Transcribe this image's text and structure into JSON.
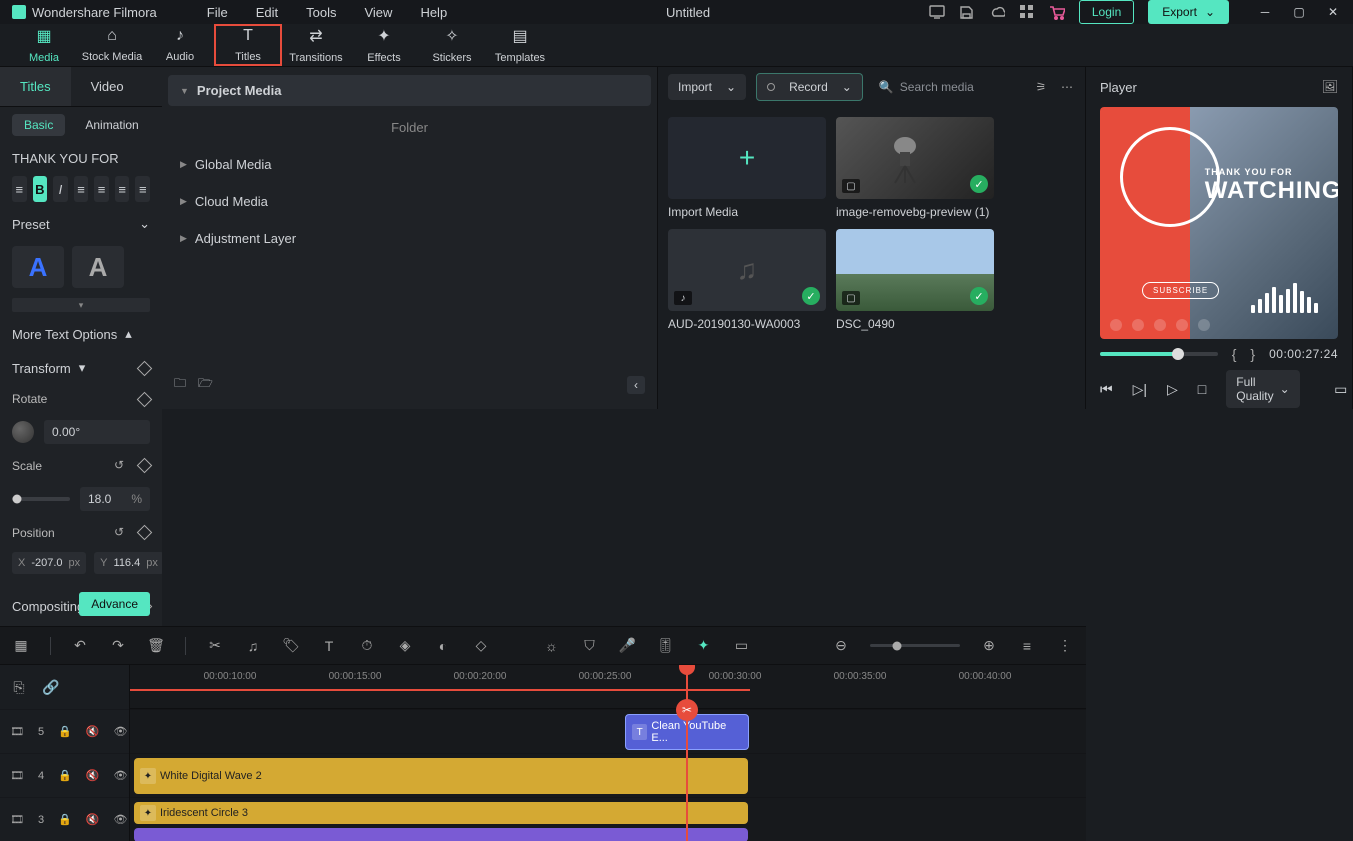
{
  "app_name": "Wondershare Filmora",
  "menu": [
    "File",
    "Edit",
    "Tools",
    "View",
    "Help"
  ],
  "doc_title": "Untitled",
  "login": "Login",
  "export": "Export",
  "tabs": {
    "media": "Media",
    "stock": "Stock Media",
    "audio": "Audio",
    "titles": "Titles",
    "transitions": "Transitions",
    "effects": "Effects",
    "stickers": "Stickers",
    "templates": "Templates"
  },
  "sidebar": {
    "project": "Project Media",
    "folder": "Folder",
    "global": "Global Media",
    "cloud": "Cloud Media",
    "adjust": "Adjustment Layer"
  },
  "media": {
    "import": "Import",
    "record": "Record",
    "search_ph": "Search media",
    "items": [
      {
        "label": "Import Media"
      },
      {
        "label": "image-removebg-preview (1)"
      },
      {
        "label": "AUD-20190130-WA0003"
      },
      {
        "label": "DSC_0490"
      }
    ]
  },
  "player": {
    "title": "Player",
    "preview": {
      "small": "THANK YOU FOR",
      "big": "WATCHING",
      "sub": "SUBSCRIBE"
    },
    "time": "00:00:27:24",
    "quality": "Full Quality"
  },
  "inspector": {
    "tabs": {
      "titles": "Titles",
      "video": "Video"
    },
    "sub": {
      "basic": "Basic",
      "animation": "Animation"
    },
    "text_value": "THANK YOU FOR",
    "preset": "Preset",
    "more_opts": "More Text Options",
    "transform": "Transform",
    "rotate_label": "Rotate",
    "rotate_value": "0.00°",
    "scale_label": "Scale",
    "scale_value": "18.0",
    "scale_unit": "%",
    "position_label": "Position",
    "pos_x": "-207.0",
    "pos_y": "116.4",
    "unit_px": "px",
    "compositing": "Compositing",
    "advance": "Advance"
  },
  "timeline": {
    "ticks": [
      "00:00:10:00",
      "00:00:15:00",
      "00:00:20:00",
      "00:00:25:00",
      "00:00:30:00",
      "00:00:35:00",
      "00:00:40:00"
    ],
    "tracks": [
      "5",
      "4",
      "3"
    ],
    "clips": {
      "title": "Clean YouTube E...",
      "wave": "White  Digital Wave 2",
      "circle": "Iridescent Circle 3"
    }
  }
}
